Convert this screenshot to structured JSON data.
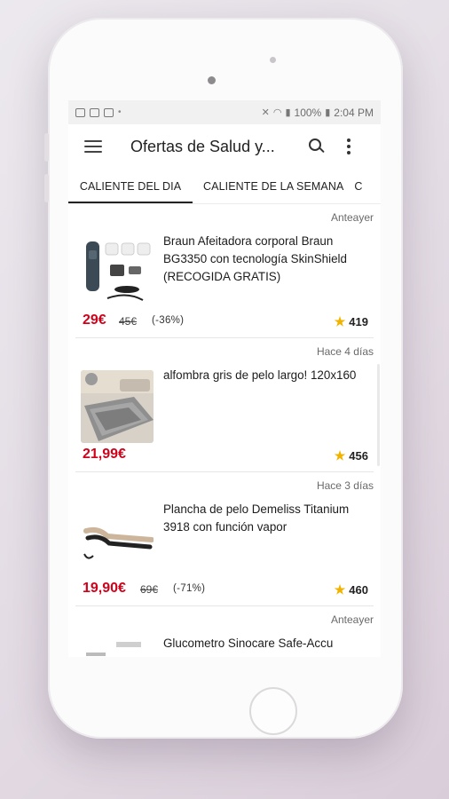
{
  "status_bar": {
    "battery": "100%",
    "time": "2:04 PM"
  },
  "app_bar": {
    "title": "Ofertas de Salud y..."
  },
  "tabs": [
    {
      "label": "CALIENTE DEL DIA"
    },
    {
      "label": "CALIENTE DE LA SEMANA"
    },
    {
      "label": "C"
    }
  ],
  "deals": [
    {
      "date": "Anteayer",
      "title": "Braun Afeitadora corporal Braun BG3350 con tecnología SkinShield (RECOGIDA GRATIS)",
      "price": "29€",
      "old_price": "45€",
      "discount": "(-36%)",
      "rating": "419"
    },
    {
      "date": "Hace 4 días",
      "title": "alfombra gris de pelo largo! 120x160",
      "price": "21,99€",
      "rating": "456"
    },
    {
      "date": "Hace 3 días",
      "title": "Plancha de pelo Demeliss Titanium 3918 con función vapor",
      "price": "19,90€",
      "old_price": "69€",
      "discount": "(-71%)",
      "rating": "460"
    },
    {
      "date": "Anteayer",
      "title": "Glucometro Sinocare Safe-Accu"
    }
  ],
  "colors": {
    "price": "#d0021b",
    "star": "#f0b400"
  }
}
